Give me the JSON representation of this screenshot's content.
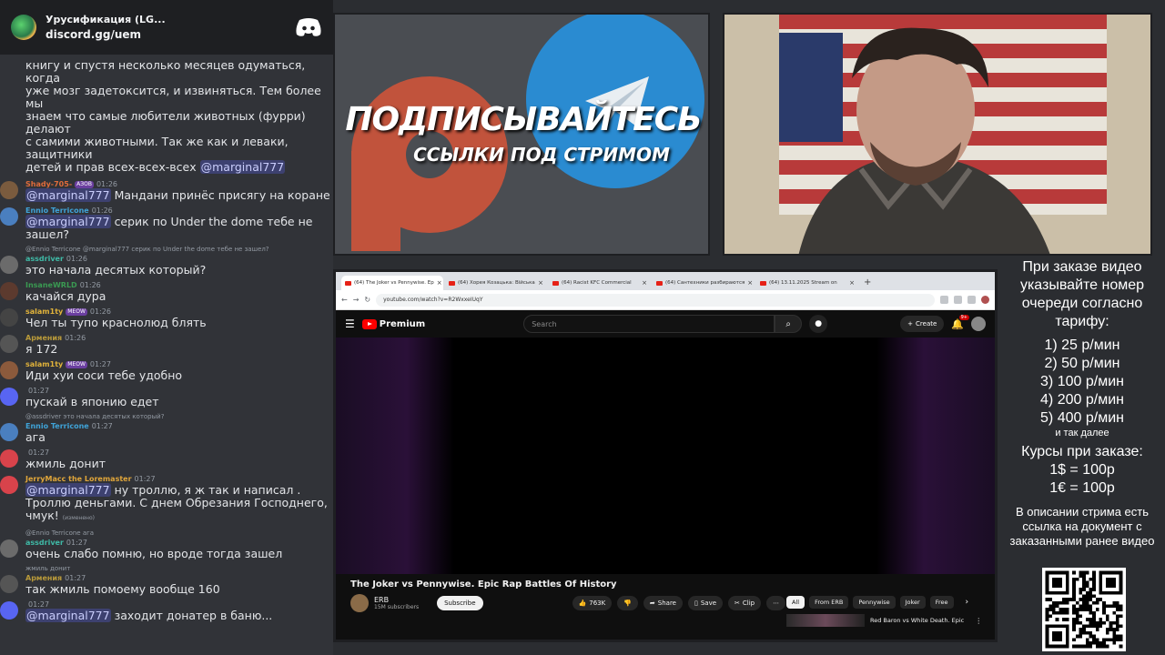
{
  "invite": {
    "title": "Урусификация (LG...",
    "link": "discord.gg/uem"
  },
  "chat_top": {
    "lines": [
      "книгу и спустя несколько месяцев одуматься, когда",
      "уже мозг задетоксится, и извиняться. Тем более мы",
      "знаем что самые любители животных (фурри) делают",
      "с самими животными. Так же как и леваки, защитники",
      "детей и прав всех-всех-всех"
    ],
    "mention": "@marginal777"
  },
  "messages": [
    {
      "user": "Shady-705-",
      "badge": "АЗОВ",
      "time": "01:26",
      "mention": "@marginal777",
      "text": "Мандани принёс присягу на коране",
      "color": "#e06c3a"
    },
    {
      "user": "Ennio Terricone",
      "time": "01:26",
      "mention": "@marginal777",
      "text": "серик по Under the dome тебе не зашел?",
      "color": "#3fa3d8"
    },
    {
      "reply_user": "@Ennio Terricone",
      "reply_mention": "@marginal777",
      "reply_text": "серик по Under the dome тебе не зашел?",
      "user": "assdriver",
      "time": "01:26",
      "text": "это начала десятых который?",
      "color": "#3fb9a6"
    },
    {
      "user": "InsaneWRLD",
      "time": "01:26",
      "text": "качайся дура",
      "color": "#3a9a52"
    },
    {
      "user": "salam1ty",
      "badge": "MEOW",
      "time": "01:26",
      "text": "Чел ты тупо краснолюд блять",
      "color": "#e0b23a"
    },
    {
      "user": "Армения",
      "time": "01:26",
      "text": "я 172",
      "color": "#b99a3a"
    },
    {
      "user": "salam1ty",
      "badge": "MEOW",
      "time": "01:27",
      "text": "Иди хуи соси тебе удобно",
      "color": "#e0b23a"
    },
    {
      "user": "",
      "time": "01:27",
      "text": "пускай в японию едет",
      "color": "#c06bd6"
    },
    {
      "reply_user": "@assdriver",
      "reply_text": "это начала десятых который?",
      "user": "Ennio Terricone",
      "time": "01:27",
      "text": "ага",
      "color": "#3fa3d8"
    },
    {
      "user": "",
      "time": "01:27",
      "text": "жмиль донит",
      "color": "#d8434b"
    },
    {
      "user": "JerryMacc the Loremaster",
      "time": "01:27",
      "mention": "@marginal777",
      "text": "ну троллю, я ж так и написал . Троллю деньгами. С днем Обрезания Господнего, чмук!",
      "edited": "(изменено)",
      "color": "#e0a63a"
    },
    {
      "reply_user": "@Ennio Terricone",
      "reply_text": "ага",
      "user": "assdriver",
      "time": "01:27",
      "text": "очень слабо помню, но вроде тогда зашел",
      "color": "#3fb9a6"
    },
    {
      "reply_user": "",
      "reply_text": "жмиль донит",
      "user": "Армения",
      "time": "01:27",
      "text": "так жмиль помоему вообще 160",
      "color": "#b99a3a"
    },
    {
      "user": "",
      "time": "01:27",
      "mention": "@marginal777",
      "text": "заходит донатер в баню...",
      "color": "#c06bd6"
    }
  ],
  "banner": {
    "headline": "ПОДПИСЫВАЙТЕСЬ",
    "subline": "ССЫЛКИ ПОД СТРИМОМ"
  },
  "browser": {
    "tabs": [
      "(64) The Joker vs Pennywise. Ep",
      "(64) Хорея Козацька: Війська",
      "(64) Racist KFC Commercial",
      "(64) Сантехники разбираются",
      "(64) 13.11.2025 Stream on"
    ],
    "url": "youtube.com/watch?v=R2WxxeIUqY",
    "brand": "Premium",
    "search_placeholder": "Search",
    "create": "Create",
    "notif_count": "9+",
    "video_title": "The Joker vs Pennywise. Epic Rap Battles Of History",
    "channel": "ERB",
    "subscribers": "15M subscribers",
    "subscribe": "Subscribe",
    "likes": "763K",
    "share": "Share",
    "save": "Save",
    "clip": "Clip",
    "chips": [
      "All",
      "From ERB",
      "Pennywise",
      "Joker",
      "Free"
    ],
    "rec_title": "Red Baron vs White Death. Epic"
  },
  "price": {
    "intro": "При заказе видео указывайте номер очереди согласно тарифу:",
    "tiers": [
      "1) 25 р/мин",
      "2) 50 р/мин",
      "3) 100 р/мин",
      "4) 200 р/мин",
      "5) 400 р/мин"
    ],
    "etc": "и так далее",
    "rates_title": "Курсы при заказе:",
    "rates": [
      "1$ = 100р",
      "1€ = 100р"
    ],
    "footer": "В описании стрима есть ссылка на документ с заказанными ранее видео"
  }
}
